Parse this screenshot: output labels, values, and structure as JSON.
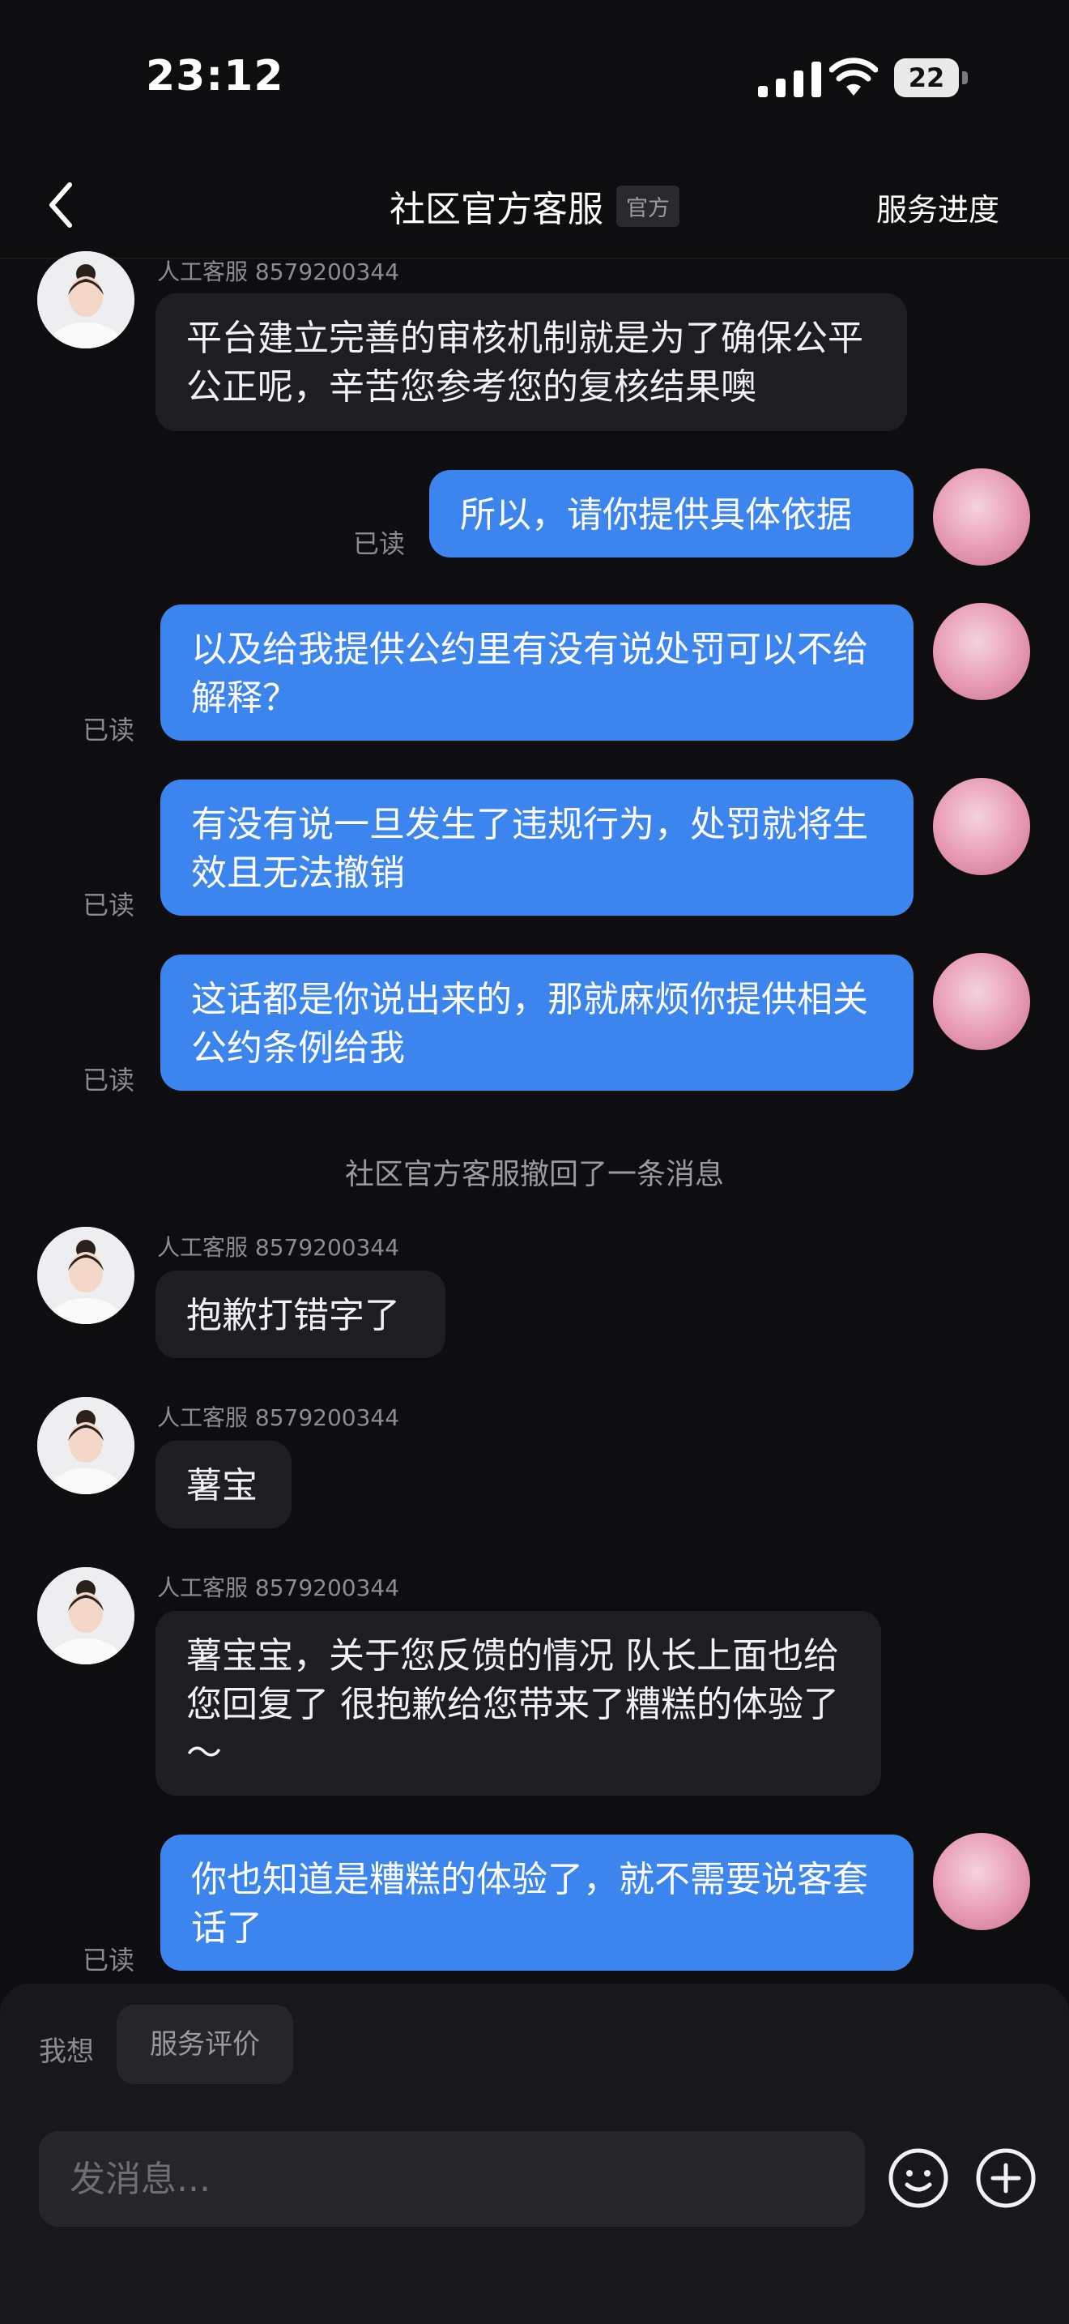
{
  "status_bar": {
    "time": "23:12",
    "battery": "22"
  },
  "nav": {
    "title": "社区官方客服",
    "badge": "官方",
    "right_action": "服务进度"
  },
  "messages": {
    "m1": {
      "sender": "人工客服 8579200344",
      "text": "平台建立完善的审核机制就是为了确保公平公正呢，辛苦您参考您的复核结果噢"
    },
    "m2": {
      "text": "所以，请你提供具体依据",
      "status": "已读"
    },
    "m3": {
      "text": "以及给我提供公约里有没有说处罚可以不给解释？",
      "status": "已读"
    },
    "m4": {
      "text": "有没有说一旦发生了违规行为，处罚就将生效且无法撤销",
      "status": "已读"
    },
    "m5": {
      "text": "这话都是你说出来的，那就麻烦你提供相关公约条例给我",
      "status": "已读"
    },
    "system": "社区官方客服撤回了一条消息",
    "m6": {
      "sender": "人工客服 8579200344",
      "text": "抱歉打错字了"
    },
    "m7": {
      "sender": "人工客服 8579200344",
      "text": "薯宝"
    },
    "m8": {
      "sender": "人工客服 8579200344",
      "text": "薯宝宝，关于您反馈的情况 队长上面也给您回复了 很抱歉给您带来了糟糕的体验了～"
    },
    "m9": {
      "text": "你也知道是糟糕的体验了，就不需要说客套话了",
      "status": "已读"
    }
  },
  "bottom": {
    "quick_label": "我想",
    "quick_chip": "服务评价",
    "input_placeholder": "发消息..."
  }
}
